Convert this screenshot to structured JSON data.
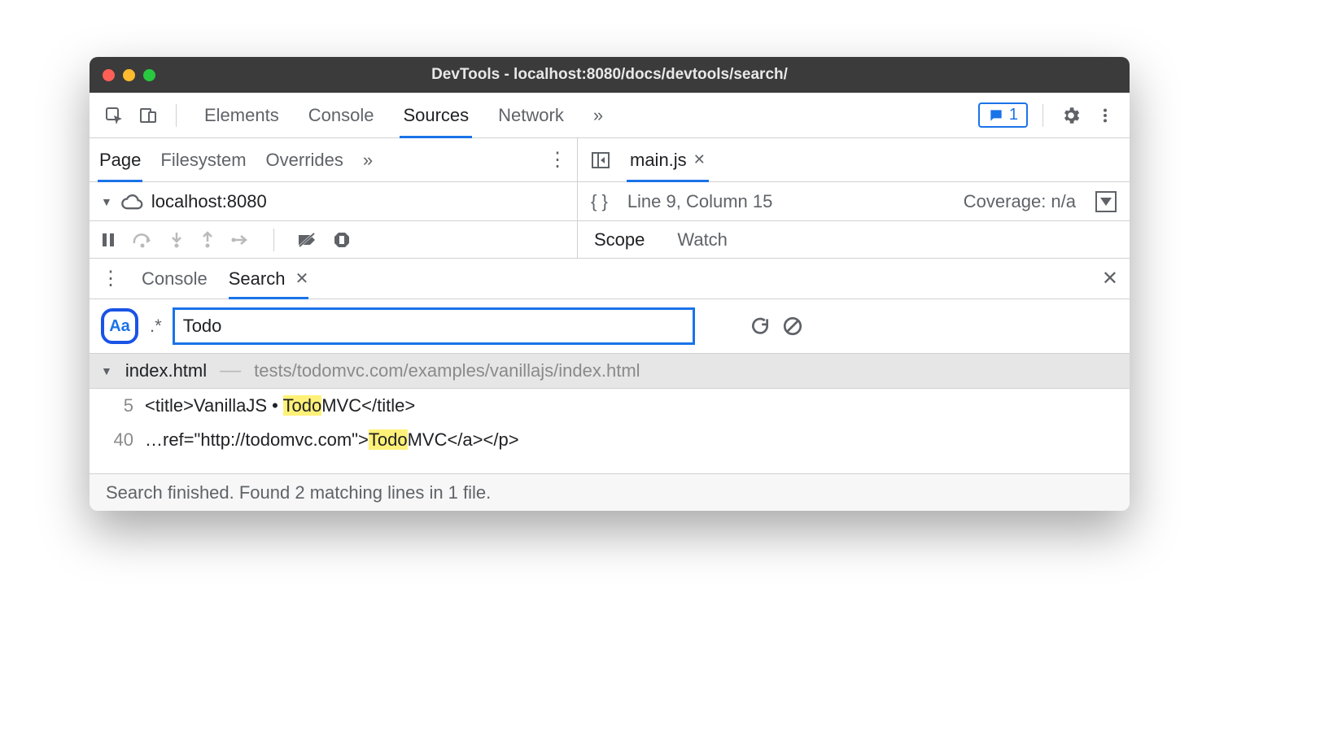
{
  "window": {
    "title": "DevTools - localhost:8080/docs/devtools/search/"
  },
  "toolbar": {
    "tabs": [
      "Elements",
      "Console",
      "Sources",
      "Network"
    ],
    "active_tab": "Sources",
    "overflow": "»",
    "badge_count": "1"
  },
  "sources": {
    "left_tabs": [
      "Page",
      "Filesystem",
      "Overrides"
    ],
    "left_overflow": "»",
    "tree_root": "localhost:8080",
    "open_file": "main.js",
    "cursor": "Line 9, Column 15",
    "coverage": "Coverage: n/a",
    "right_tabs": [
      "Scope",
      "Watch"
    ]
  },
  "drawer": {
    "tabs": [
      "Console",
      "Search"
    ],
    "active": "Search"
  },
  "search": {
    "case_label": "Aa",
    "regex_label": ".*",
    "query": "Todo",
    "result_file": "index.html",
    "result_path": "tests/todomvc.com/examples/vanillajs/index.html",
    "lines": [
      {
        "num": "5",
        "pre": "<title>VanillaJS • ",
        "match": "Todo",
        "post": "MVC</title>"
      },
      {
        "num": "40",
        "pre": "…ref=\"http://todomvc.com\">",
        "match": "Todo",
        "post": "MVC</a></p>"
      }
    ],
    "status": "Search finished.  Found 2 matching lines in 1 file."
  }
}
